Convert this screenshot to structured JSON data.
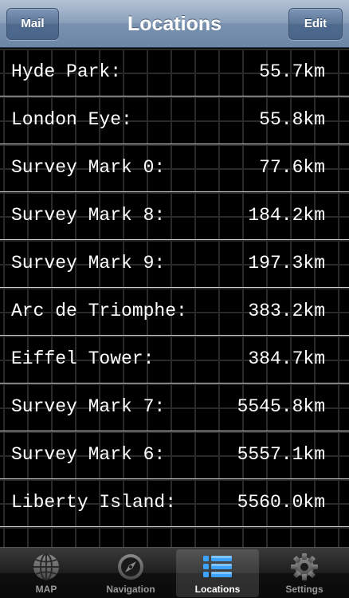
{
  "navbar": {
    "title": "Locations",
    "left_button": "Mail",
    "right_button": "Edit"
  },
  "locations": [
    {
      "name": "Hyde Park:",
      "distance": "55.7km"
    },
    {
      "name": "London Eye:",
      "distance": "55.8km"
    },
    {
      "name": "Survey Mark 0:",
      "distance": "77.6km"
    },
    {
      "name": "Survey Mark 8:",
      "distance": "184.2km"
    },
    {
      "name": "Survey Mark 9:",
      "distance": "197.3km"
    },
    {
      "name": "Arc de Triomphe:",
      "distance": "383.2km"
    },
    {
      "name": "Eiffel Tower:",
      "distance": "384.7km"
    },
    {
      "name": "Survey Mark 7:",
      "distance": "5545.8km"
    },
    {
      "name": "Survey Mark 6:",
      "distance": "5557.1km"
    },
    {
      "name": "Liberty Island:",
      "distance": "5560.0km"
    }
  ],
  "tabbar": {
    "tabs": [
      {
        "label": "MAP",
        "icon": "globe-icon"
      },
      {
        "label": "Navigation",
        "icon": "compass-icon"
      },
      {
        "label": "Locations",
        "icon": "list-icon"
      },
      {
        "label": "Settings",
        "icon": "gear-icon"
      }
    ],
    "active_tab": "Locations"
  },
  "colors": {
    "navbar": "#8aa0ba",
    "background": "#000000",
    "row_divider": "#cfcfcf",
    "active_icon": "#3ea3ff"
  }
}
